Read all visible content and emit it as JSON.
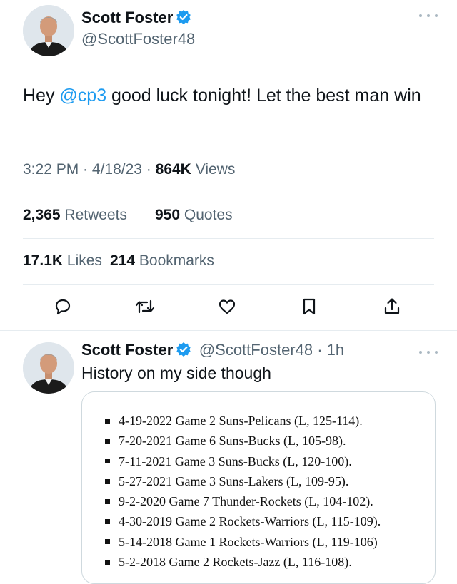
{
  "tweet": {
    "author_name": "Scott Foster",
    "author_handle": "@ScottFoster48",
    "text_prefix": "Hey ",
    "mention": "@cp3",
    "text_suffix": " good luck tonight! Let the best man win",
    "time": "3:22 PM",
    "date": "4/18/23",
    "views_count": "864K",
    "views_label": "Views",
    "retweets_count": "2,365",
    "retweets_label": "Retweets",
    "quotes_count": "950",
    "quotes_label": "Quotes",
    "likes_count": "17.1K",
    "likes_label": "Likes",
    "bookmarks_count": "214",
    "bookmarks_label": "Bookmarks",
    "actions": [
      "reply-icon",
      "retweet-icon",
      "like-icon",
      "bookmark-icon",
      "share-icon"
    ]
  },
  "reply": {
    "author_name": "Scott Foster",
    "author_handle": "@ScottFoster48",
    "age": "1h",
    "text": "History on my side though",
    "games": [
      "4-19-2022 Game 2 Suns-Pelicans (L, 125-114).",
      "7-20-2021 Game 6 Suns-Bucks (L, 105-98).",
      "7-11-2021 Game 3 Suns-Bucks (L, 120-100).",
      "5-27-2021 Game 3 Suns-Lakers (L, 109-95).",
      "9-2-2020 Game 7 Thunder-Rockets (L, 104-102).",
      "4-30-2019 Game 2 Rockets-Warriors (L, 115-109).",
      "5-14-2018 Game 1 Rockets-Warriors (L, 119-106)",
      "5-2-2018 Game 2 Rockets-Jazz (L, 116-108)."
    ]
  },
  "colors": {
    "accent": "#1d9bf0",
    "text": "#0f1419",
    "secondary": "#536471",
    "divider": "#e6ecf0"
  }
}
